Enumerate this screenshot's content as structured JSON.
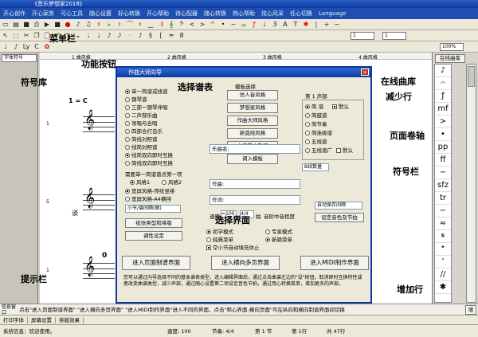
{
  "window": {
    "title": "《音乐梦想家2018》"
  },
  "menu": [
    "开心创作",
    "开心家务",
    "可心工具",
    "随心设置",
    "好心转换",
    "开心帮助",
    "待心配器",
    "随心转换",
    "热心帮助",
    "炫心风采",
    "任心切换",
    "Language"
  ],
  "toolbar2": {
    "zoom": "100%",
    "page": "1",
    "page2": "1"
  },
  "library": {
    "label": "字体符号"
  },
  "ruler": {
    "segments": [
      "1 曲风格",
      "2 曲风格",
      "3 曲风格",
      "4 曲风格"
    ]
  },
  "score": {
    "tempo": "1 = C",
    "row_nums": [
      "1",
      "5",
      "1"
    ],
    "rest": "0"
  },
  "dialog": {
    "title": "作曲大师向导",
    "score_types": [
      {
        "label": "单一简谱或线谱",
        "checked": true
      },
      {
        "label": "钢琴谱",
        "checked": false
      },
      {
        "label": "三部一钢琴伴唱",
        "checked": false
      },
      {
        "label": "二声部乐曲",
        "checked": false
      },
      {
        "label": "领唱与合唱",
        "checked": false
      },
      {
        "label": "四部合打击乐",
        "checked": false
      },
      {
        "label": "简线对照谱",
        "checked": false
      },
      {
        "label": "线简对照谱",
        "checked": false
      },
      {
        "label": "线简双向即时互换",
        "checked": true
      },
      {
        "label": "简线双向即时互换",
        "checked": false
      }
    ],
    "template_title": "模板选择",
    "templates": [
      "仿人音风格",
      "梦想家风格",
      "作曲大师风格",
      "新弧线风格",
      "小音符大歌词",
      "调入模板"
    ],
    "voice_header": "第  1  声部",
    "voices": [
      {
        "label": "简 谱",
        "checked": true,
        "extra": "默认",
        "extra_checked": true
      },
      {
        "label": "简鼓谱",
        "checked": false
      },
      {
        "label": "简节奏",
        "checked": false
      },
      {
        "label": "简连级谱",
        "checked": false
      },
      {
        "label": "五线谱",
        "checked": false
      },
      {
        "label": "五线谱广",
        "checked": false,
        "extra": "默认",
        "extra_checked": false
      }
    ],
    "section_count": "B线数量",
    "need_line": "需要单一简谱谱点第一项",
    "style_opts": [
      {
        "label": "风格1",
        "checked": true
      },
      {
        "label": "风格2",
        "checked": false
      }
    ],
    "paper_opts": [
      {
        "label": "宽屏风格-传统竖排",
        "checked": true
      },
      {
        "label": "宽屏风格-A4横排",
        "checked": false
      }
    ],
    "small_score_select": "小节/谱间隔(图)",
    "btn_paper": "纸张类型和排版",
    "btn_tune": "调性设定",
    "fields": [
      {
        "label": "乐曲名:",
        "value": ""
      },
      {
        "label": "作曲:",
        "value": ""
      },
      {
        "label": "作词:",
        "value": ""
      }
    ],
    "speed_label": "速度",
    "speed_value": "=100",
    "beat_value": "4/4",
    "beat_label": "拍",
    "scale_label": "音阶中音程度",
    "auto_save": "自动保存间隔",
    "btn_set_sound": "设定音色及节拍",
    "modes": [
      {
        "label": "初学模式",
        "checked": true
      },
      {
        "label": "专家模式",
        "checked": false
      },
      {
        "label": "经典菜单",
        "checked": false
      },
      {
        "label": "新颖菜单",
        "checked": true
      }
    ],
    "empty_check": "空小节自动填充休止",
    "btn_page": "进入页面制谱界面",
    "btn_horizontal": "进入横向多页界面",
    "btn_midi": "进入MIDI制作界面",
    "help_text": "您可以通过向导选择不同的基本谱表类型，进入编辑界面后，通过点击曲谱左边的\"设\"按钮，取消即时互换特性或者改变曲谱类型，减少声部，通过随心设置第二项设定音色节拍，通过用心转换菜单，增加更多的声部。"
  },
  "annotations": {
    "menu_bar": "菜单栏",
    "function_btn": "功能按钮",
    "symbol_lib": "符号库",
    "score_table": "选择谱表",
    "online_lib": "在线曲库",
    "reduce_row": "减少行",
    "page_scroll": "页面卷轴",
    "symbol_bar": "符号栏",
    "select_ui": "选择界面",
    "hint_bar": "提示栏",
    "add_row": "增加行"
  },
  "online_lib_btn": "在线曲库",
  "info": {
    "label": "信息窗口",
    "text": "点击\"进入页面制谱界面\"  \"进入横向多页界面\"  \"进入MIDI制作界面\"进入不同的界面，点击\"称心界面-横向页面\"可在纵向和横向制谱界面间切换"
  },
  "add_btn": "增加",
  "tabs": [
    "打印字体",
    "屏幕设置",
    "排版效果"
  ],
  "status": {
    "state": "系统信息：欢迎使用。",
    "speed": "速度: 100",
    "beat": "节奏: 4/4",
    "section": "第 1 节",
    "row": "第 1行",
    "total": "共 47行"
  }
}
